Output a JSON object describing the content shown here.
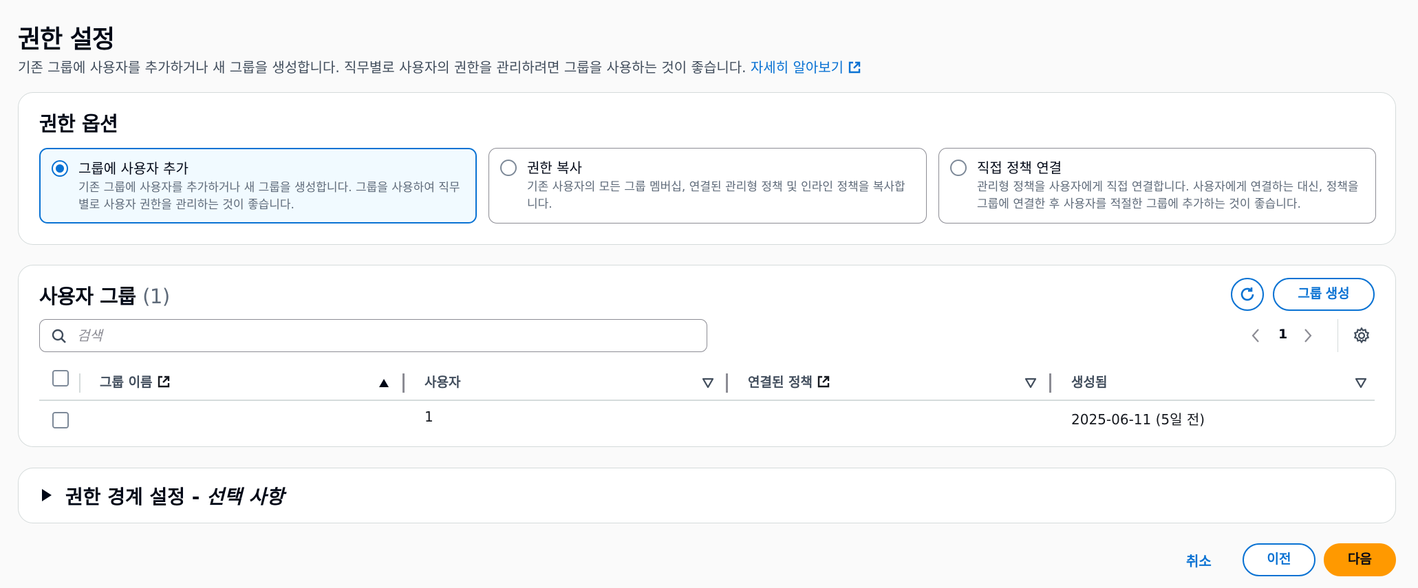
{
  "page": {
    "title": "권한 설정",
    "description": "기존 그룹에 사용자를 추가하거나 새 그룹을 생성합니다. 직무별로 사용자의 권한을 관리하려면 그룹을 사용하는 것이 좋습니다.",
    "learn_more": "자세히 알아보기"
  },
  "options": {
    "title": "권한 옵션",
    "selected": 0,
    "tiles": [
      {
        "label": "그룹에 사용자 추가",
        "description": "기존 그룹에 사용자를 추가하거나 새 그룹을 생성합니다. 그룹을 사용하여 직무별로 사용자 권한을 관리하는 것이 좋습니다."
      },
      {
        "label": "권한 복사",
        "description": "기존 사용자의 모든 그룹 멤버십, 연결된 관리형 정책 및 인라인 정책을 복사합니다."
      },
      {
        "label": "직접 정책 연결",
        "description": "관리형 정책을 사용자에게 직접 연결합니다. 사용자에게 연결하는 대신, 정책을 그룹에 연결한 후 사용자를 적절한 그룹에 추가하는 것이 좋습니다."
      }
    ]
  },
  "groups": {
    "title": "사용자 그룹",
    "count": "(1)",
    "create_button": "그룹 생성",
    "search_placeholder": "검색",
    "search_value": "",
    "page": "1",
    "columns": [
      {
        "label": "그룹 이름",
        "sort": "ascending",
        "external_link": true
      },
      {
        "label": "사용자",
        "sort": "none",
        "external_link": false
      },
      {
        "label": "연결된 정책",
        "sort": "none",
        "external_link": true
      },
      {
        "label": "생성됨",
        "sort": "none",
        "external_link": false
      }
    ],
    "rows": [
      {
        "group_name": "",
        "users": "1",
        "policies": "",
        "created": "2025-06-11 (5일 전)"
      }
    ]
  },
  "boundary": {
    "title": "권한 경계 설정 - ",
    "title_optional": "선택 사항"
  },
  "footer": {
    "cancel": "취소",
    "previous": "이전",
    "next": "다음"
  },
  "colors": {
    "accent": "#0972d3",
    "primary_button": "#ff9900",
    "selected_tile_bg": "#f1faff"
  },
  "icons": [
    "external-link-icon",
    "radio-icon",
    "refresh-icon",
    "search-icon",
    "chevron-left-icon",
    "chevron-right-icon",
    "settings-icon",
    "sort-ascending-icon",
    "sort-icon",
    "caret-right-icon"
  ]
}
